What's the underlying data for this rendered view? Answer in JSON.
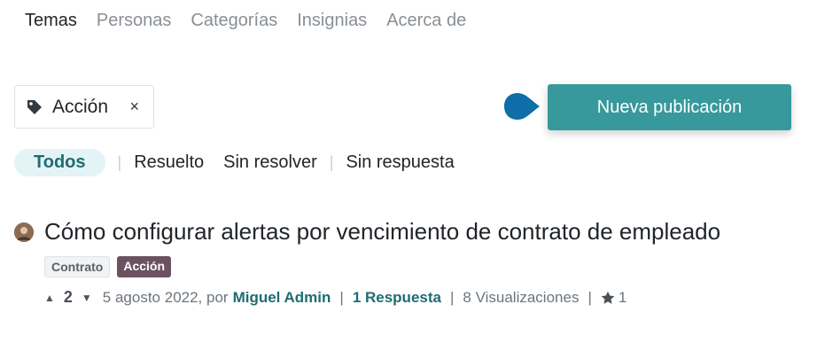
{
  "nav": {
    "items": [
      {
        "label": "Temas"
      },
      {
        "label": "Personas"
      },
      {
        "label": "Categorías"
      },
      {
        "label": "Insignias"
      },
      {
        "label": "Acerca de"
      }
    ]
  },
  "tag_filter": {
    "label": "Acción",
    "remove": "×",
    "icon": "tag-icon"
  },
  "actions": {
    "new_post": "Nueva publicación"
  },
  "filters": [
    {
      "label": "Todos"
    },
    {
      "label": "Resuelto"
    },
    {
      "label": "Sin resolver"
    },
    {
      "label": "Sin respuesta"
    }
  ],
  "filter_separator": "|",
  "post": {
    "title": "Cómo configurar alertas por vencimiento de contrato de empleado",
    "tags": [
      "Contrato",
      "Acción"
    ],
    "votes": "2",
    "date_prefix": "5 agosto 2022, por",
    "author": "Miguel Admin",
    "answers": "1 Respuesta",
    "views": "8 Visualizaciones",
    "favorites": "1",
    "sep": "|"
  },
  "colors": {
    "accent": "#37999b",
    "link": "#1e6c73",
    "badge_accion": "#6b5261",
    "bubble": "#0f6da7"
  }
}
